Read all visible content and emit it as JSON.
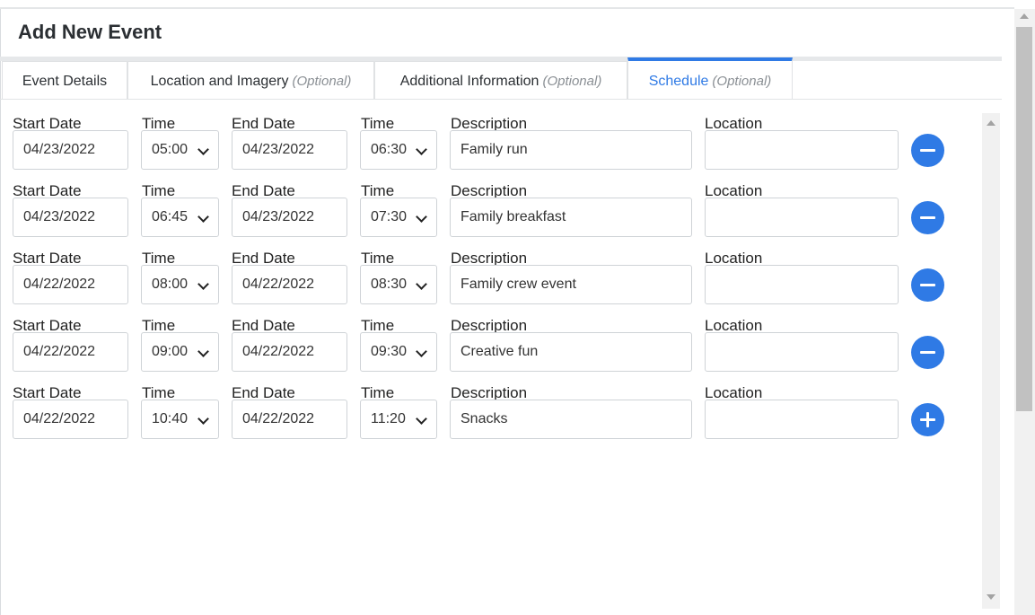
{
  "dialog": {
    "title": "Add New Event"
  },
  "tabs": [
    {
      "label": "Event Details",
      "optional": ""
    },
    {
      "label": "Location and Imagery",
      "optional": "(Optional)"
    },
    {
      "label": "Additional Information",
      "optional": "(Optional)"
    },
    {
      "label": "Schedule",
      "optional": "(Optional)",
      "active": true
    }
  ],
  "labels": {
    "start_date": "Start Date",
    "time": "Time",
    "end_date": "End Date",
    "description": "Description",
    "location": "Location"
  },
  "schedule": [
    {
      "start_date": "04/23/2022",
      "start_time": "05:00",
      "end_date": "04/23/2022",
      "end_time": "06:30",
      "description": "Family run",
      "location": "",
      "action": "remove"
    },
    {
      "start_date": "04/23/2022",
      "start_time": "06:45",
      "end_date": "04/23/2022",
      "end_time": "07:30",
      "description": "Family breakfast",
      "location": "",
      "action": "remove"
    },
    {
      "start_date": "04/22/2022",
      "start_time": "08:00",
      "end_date": "04/22/2022",
      "end_time": "08:30",
      "description": "Family crew event",
      "location": "",
      "action": "remove"
    },
    {
      "start_date": "04/22/2022",
      "start_time": "09:00",
      "end_date": "04/22/2022",
      "end_time": "09:30",
      "description": "Creative fun",
      "location": "",
      "action": "remove"
    },
    {
      "start_date": "04/22/2022",
      "start_time": "10:40",
      "end_date": "04/22/2022",
      "end_time": "11:20",
      "description": "Snacks",
      "location": "",
      "action": "add"
    }
  ],
  "icons": {
    "remove": "minus-circle-icon",
    "add": "plus-circle-icon",
    "select": "chevron-down-icon"
  },
  "colors": {
    "accent": "#2f7ae5",
    "optional_text": "#8a8f94"
  }
}
